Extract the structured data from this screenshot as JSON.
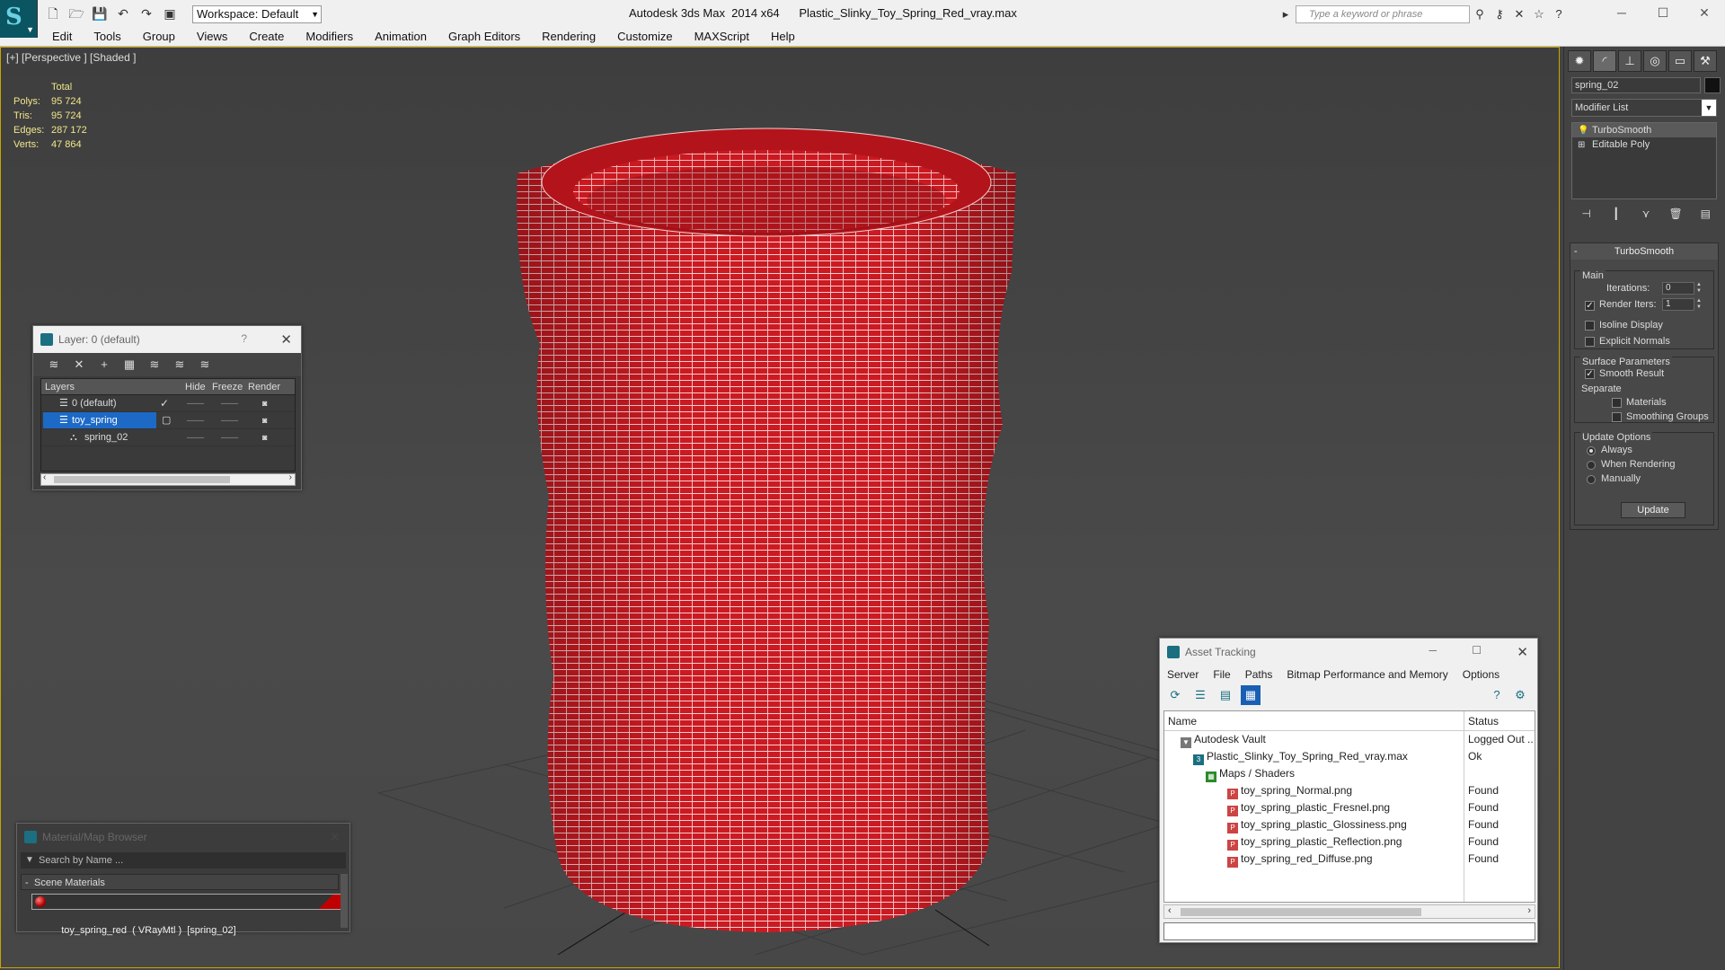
{
  "app": {
    "title": "Autodesk 3ds Max  2014 x64      Plastic_Slinky_Toy_Spring_Red_vray.max",
    "workspace": "Workspace: Default",
    "search_placeholder": "Type a keyword or phrase"
  },
  "menu": [
    "Edit",
    "Tools",
    "Group",
    "Views",
    "Create",
    "Modifiers",
    "Animation",
    "Graph Editors",
    "Rendering",
    "Customize",
    "MAXScript",
    "Help"
  ],
  "viewport": {
    "label": "[+] [Perspective ] [Shaded ]",
    "stats": {
      "header": "Total",
      "rows": [
        {
          "k": "Polys:",
          "v": "95 724"
        },
        {
          "k": "Tris:",
          "v": "95 724"
        },
        {
          "k": "Edges:",
          "v": "287 172"
        },
        {
          "k": "Verts:",
          "v": "47 864"
        }
      ]
    },
    "object_color": "#cc1a22",
    "frame_color": "#c8a400"
  },
  "command_panel": {
    "object_name": "spring_02",
    "modifier_list": "Modifier List",
    "stack": [
      "TurboSmooth",
      "Editable Poly"
    ],
    "turbosmooth": {
      "title": "TurboSmooth",
      "main": "Main",
      "iterations_label": "Iterations:",
      "iterations": "0",
      "render_iters_label": "Render Iters:",
      "render_iters": "1",
      "isoline": "Isoline Display",
      "explicit": "Explicit Normals",
      "surface": "Surface Parameters",
      "smooth_result": "Smooth Result",
      "separate": "Separate",
      "materials": "Materials",
      "smoothing_groups": "Smoothing Groups",
      "update_options": "Update Options",
      "always": "Always",
      "when_rendering": "When Rendering",
      "manually": "Manually",
      "update": "Update"
    }
  },
  "layer_dialog": {
    "title": "Layer: 0 (default)",
    "help": "?",
    "columns": {
      "layers": "Layers",
      "hide": "Hide",
      "freeze": "Freeze",
      "render": "Render"
    },
    "rows": [
      {
        "name": "0 (default)"
      },
      {
        "name": "toy_spring"
      },
      {
        "name": "spring_02"
      }
    ]
  },
  "material_browser": {
    "title": "Material/Map Browser",
    "search": "Search by Name ...",
    "group": "Scene Materials",
    "item": "toy_spring_red  ( VRayMtl )  [spring_02]"
  },
  "asset_tracking": {
    "title": "Asset Tracking",
    "menu": [
      "Server",
      "File",
      "Paths",
      "Bitmap Performance and Memory",
      "Options"
    ],
    "columns": {
      "name": "Name",
      "status": "Status"
    },
    "rows": [
      {
        "name": "Autodesk Vault",
        "status": "Logged Out ...",
        "indent": 1,
        "icon": "vault-icon"
      },
      {
        "name": "Plastic_Slinky_Toy_Spring_Red_vray.max",
        "status": "Ok",
        "indent": 2,
        "icon": "max-file-icon"
      },
      {
        "name": "Maps / Shaders",
        "status": "",
        "indent": 3,
        "icon": "maps-folder-icon"
      },
      {
        "name": "toy_spring_Normal.png",
        "status": "Found",
        "indent": 4,
        "icon": "png-file-icon"
      },
      {
        "name": "toy_spring_plastic_Fresnel.png",
        "status": "Found",
        "indent": 4,
        "icon": "png-file-icon"
      },
      {
        "name": "toy_spring_plastic_Glossiness.png",
        "status": "Found",
        "indent": 4,
        "icon": "png-file-icon"
      },
      {
        "name": "toy_spring_plastic_Reflection.png",
        "status": "Found",
        "indent": 4,
        "icon": "png-file-icon"
      },
      {
        "name": "toy_spring_red_Diffuse.png",
        "status": "Found",
        "indent": 4,
        "icon": "png-file-icon"
      }
    ]
  }
}
